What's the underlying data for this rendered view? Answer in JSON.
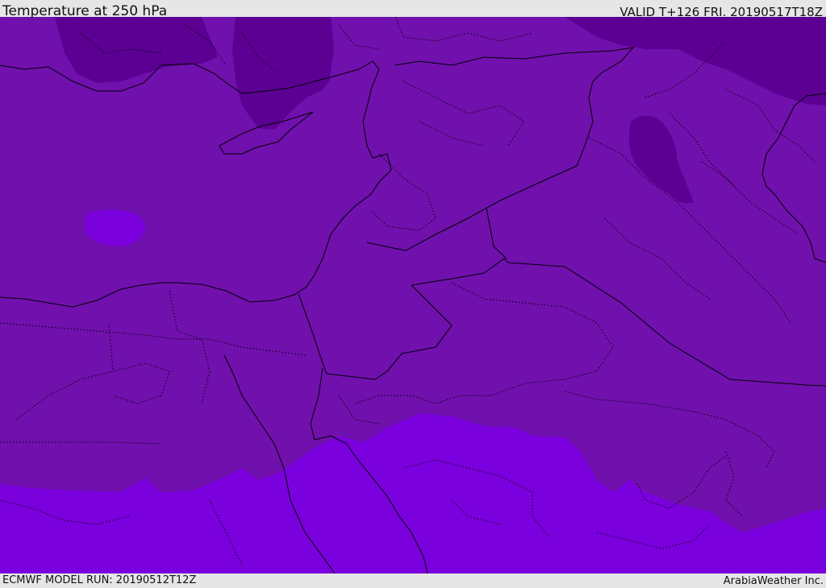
{
  "map": {
    "title": "Temperature at 250 hPa",
    "valid_time": "VALID T+126 FRI. 20190517T18Z",
    "model_run": "ECMWF MODEL RUN: 20190512T12Z",
    "credit": "ArabiaWeather Inc.",
    "colors": {
      "cold": "#5c0094",
      "mid": "#7010ad",
      "warm": "#7a00dd",
      "coast": "#000000",
      "border": "#000000"
    }
  }
}
